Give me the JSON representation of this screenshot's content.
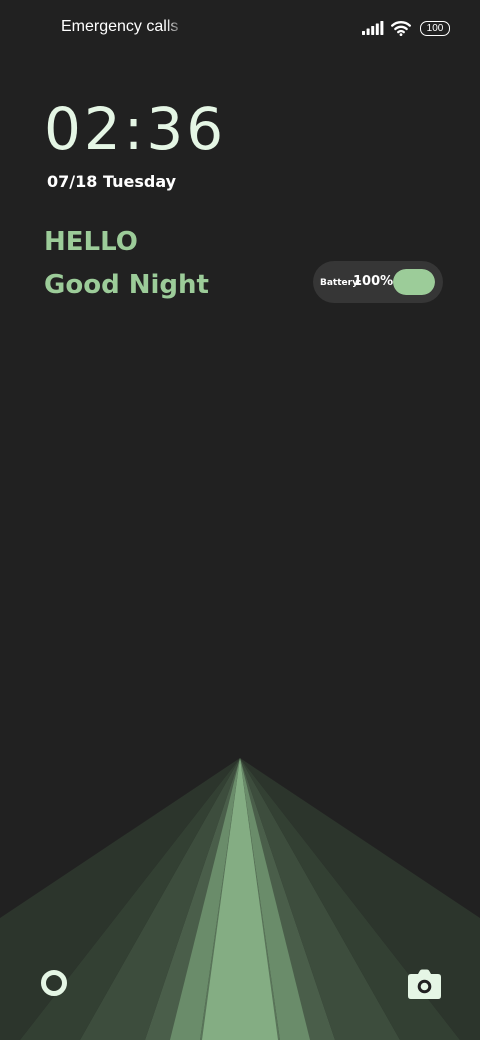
{
  "status_bar": {
    "carrier_text": "Emergency calls only",
    "battery_level": "100",
    "icons": [
      "signal-icon",
      "wifi-icon",
      "battery-icon"
    ]
  },
  "lockscreen": {
    "time": "02:36",
    "date": "07/18 Tuesday",
    "greeting": "HELLO",
    "message": "Good Night"
  },
  "battery_widget": {
    "label": "Battery:",
    "value_text": "100%",
    "level_percent": 100
  },
  "shortcuts": {
    "left_icon": "lock-ring-icon",
    "right_icon": "camera-icon"
  },
  "colors": {
    "background": "#212121",
    "accent": "#9ccc99",
    "clock": "#e5f6e5",
    "ray_shades": [
      "#2c352c",
      "#334033",
      "#3d4d3d",
      "#4a5e4a",
      "#597459",
      "#6a8c6a",
      "#84ad83"
    ]
  }
}
